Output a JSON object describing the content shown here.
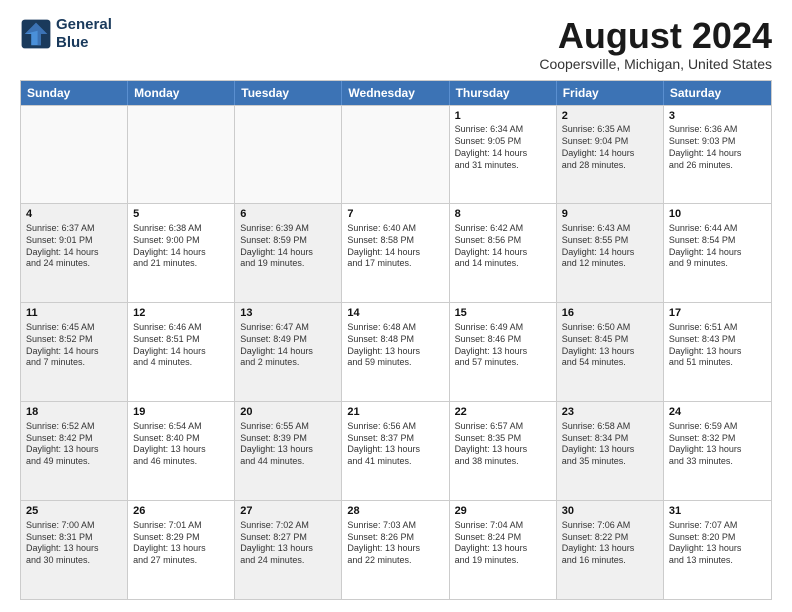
{
  "logo": {
    "line1": "General",
    "line2": "Blue"
  },
  "title": "August 2024",
  "subtitle": "Coopersville, Michigan, United States",
  "header_days": [
    "Sunday",
    "Monday",
    "Tuesday",
    "Wednesday",
    "Thursday",
    "Friday",
    "Saturday"
  ],
  "rows": [
    [
      {
        "day": "",
        "info": "",
        "shaded": false,
        "empty": true
      },
      {
        "day": "",
        "info": "",
        "shaded": false,
        "empty": true
      },
      {
        "day": "",
        "info": "",
        "shaded": false,
        "empty": true
      },
      {
        "day": "",
        "info": "",
        "shaded": false,
        "empty": true
      },
      {
        "day": "1",
        "info": "Sunrise: 6:34 AM\nSunset: 9:05 PM\nDaylight: 14 hours\nand 31 minutes.",
        "shaded": false,
        "empty": false
      },
      {
        "day": "2",
        "info": "Sunrise: 6:35 AM\nSunset: 9:04 PM\nDaylight: 14 hours\nand 28 minutes.",
        "shaded": true,
        "empty": false
      },
      {
        "day": "3",
        "info": "Sunrise: 6:36 AM\nSunset: 9:03 PM\nDaylight: 14 hours\nand 26 minutes.",
        "shaded": false,
        "empty": false
      }
    ],
    [
      {
        "day": "4",
        "info": "Sunrise: 6:37 AM\nSunset: 9:01 PM\nDaylight: 14 hours\nand 24 minutes.",
        "shaded": true,
        "empty": false
      },
      {
        "day": "5",
        "info": "Sunrise: 6:38 AM\nSunset: 9:00 PM\nDaylight: 14 hours\nand 21 minutes.",
        "shaded": false,
        "empty": false
      },
      {
        "day": "6",
        "info": "Sunrise: 6:39 AM\nSunset: 8:59 PM\nDaylight: 14 hours\nand 19 minutes.",
        "shaded": true,
        "empty": false
      },
      {
        "day": "7",
        "info": "Sunrise: 6:40 AM\nSunset: 8:58 PM\nDaylight: 14 hours\nand 17 minutes.",
        "shaded": false,
        "empty": false
      },
      {
        "day": "8",
        "info": "Sunrise: 6:42 AM\nSunset: 8:56 PM\nDaylight: 14 hours\nand 14 minutes.",
        "shaded": false,
        "empty": false
      },
      {
        "day": "9",
        "info": "Sunrise: 6:43 AM\nSunset: 8:55 PM\nDaylight: 14 hours\nand 12 minutes.",
        "shaded": true,
        "empty": false
      },
      {
        "day": "10",
        "info": "Sunrise: 6:44 AM\nSunset: 8:54 PM\nDaylight: 14 hours\nand 9 minutes.",
        "shaded": false,
        "empty": false
      }
    ],
    [
      {
        "day": "11",
        "info": "Sunrise: 6:45 AM\nSunset: 8:52 PM\nDaylight: 14 hours\nand 7 minutes.",
        "shaded": true,
        "empty": false
      },
      {
        "day": "12",
        "info": "Sunrise: 6:46 AM\nSunset: 8:51 PM\nDaylight: 14 hours\nand 4 minutes.",
        "shaded": false,
        "empty": false
      },
      {
        "day": "13",
        "info": "Sunrise: 6:47 AM\nSunset: 8:49 PM\nDaylight: 14 hours\nand 2 minutes.",
        "shaded": true,
        "empty": false
      },
      {
        "day": "14",
        "info": "Sunrise: 6:48 AM\nSunset: 8:48 PM\nDaylight: 13 hours\nand 59 minutes.",
        "shaded": false,
        "empty": false
      },
      {
        "day": "15",
        "info": "Sunrise: 6:49 AM\nSunset: 8:46 PM\nDaylight: 13 hours\nand 57 minutes.",
        "shaded": false,
        "empty": false
      },
      {
        "day": "16",
        "info": "Sunrise: 6:50 AM\nSunset: 8:45 PM\nDaylight: 13 hours\nand 54 minutes.",
        "shaded": true,
        "empty": false
      },
      {
        "day": "17",
        "info": "Sunrise: 6:51 AM\nSunset: 8:43 PM\nDaylight: 13 hours\nand 51 minutes.",
        "shaded": false,
        "empty": false
      }
    ],
    [
      {
        "day": "18",
        "info": "Sunrise: 6:52 AM\nSunset: 8:42 PM\nDaylight: 13 hours\nand 49 minutes.",
        "shaded": true,
        "empty": false
      },
      {
        "day": "19",
        "info": "Sunrise: 6:54 AM\nSunset: 8:40 PM\nDaylight: 13 hours\nand 46 minutes.",
        "shaded": false,
        "empty": false
      },
      {
        "day": "20",
        "info": "Sunrise: 6:55 AM\nSunset: 8:39 PM\nDaylight: 13 hours\nand 44 minutes.",
        "shaded": true,
        "empty": false
      },
      {
        "day": "21",
        "info": "Sunrise: 6:56 AM\nSunset: 8:37 PM\nDaylight: 13 hours\nand 41 minutes.",
        "shaded": false,
        "empty": false
      },
      {
        "day": "22",
        "info": "Sunrise: 6:57 AM\nSunset: 8:35 PM\nDaylight: 13 hours\nand 38 minutes.",
        "shaded": false,
        "empty": false
      },
      {
        "day": "23",
        "info": "Sunrise: 6:58 AM\nSunset: 8:34 PM\nDaylight: 13 hours\nand 35 minutes.",
        "shaded": true,
        "empty": false
      },
      {
        "day": "24",
        "info": "Sunrise: 6:59 AM\nSunset: 8:32 PM\nDaylight: 13 hours\nand 33 minutes.",
        "shaded": false,
        "empty": false
      }
    ],
    [
      {
        "day": "25",
        "info": "Sunrise: 7:00 AM\nSunset: 8:31 PM\nDaylight: 13 hours\nand 30 minutes.",
        "shaded": true,
        "empty": false
      },
      {
        "day": "26",
        "info": "Sunrise: 7:01 AM\nSunset: 8:29 PM\nDaylight: 13 hours\nand 27 minutes.",
        "shaded": false,
        "empty": false
      },
      {
        "day": "27",
        "info": "Sunrise: 7:02 AM\nSunset: 8:27 PM\nDaylight: 13 hours\nand 24 minutes.",
        "shaded": true,
        "empty": false
      },
      {
        "day": "28",
        "info": "Sunrise: 7:03 AM\nSunset: 8:26 PM\nDaylight: 13 hours\nand 22 minutes.",
        "shaded": false,
        "empty": false
      },
      {
        "day": "29",
        "info": "Sunrise: 7:04 AM\nSunset: 8:24 PM\nDaylight: 13 hours\nand 19 minutes.",
        "shaded": false,
        "empty": false
      },
      {
        "day": "30",
        "info": "Sunrise: 7:06 AM\nSunset: 8:22 PM\nDaylight: 13 hours\nand 16 minutes.",
        "shaded": true,
        "empty": false
      },
      {
        "day": "31",
        "info": "Sunrise: 7:07 AM\nSunset: 8:20 PM\nDaylight: 13 hours\nand 13 minutes.",
        "shaded": false,
        "empty": false
      }
    ]
  ]
}
